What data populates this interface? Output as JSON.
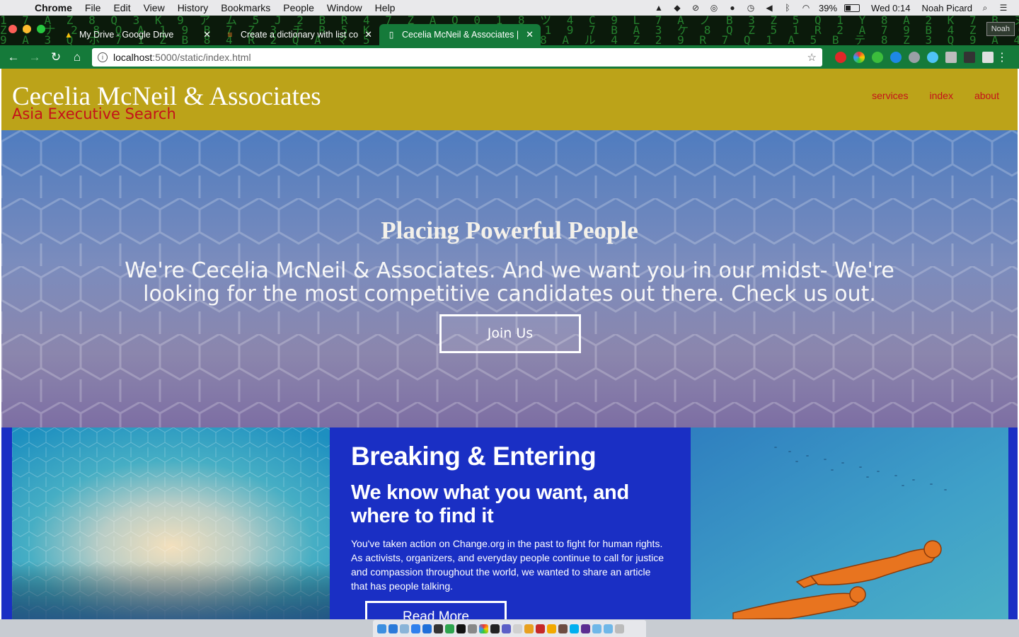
{
  "menubar": {
    "app": "Chrome",
    "items": [
      "File",
      "Edit",
      "View",
      "History",
      "Bookmarks",
      "People",
      "Window",
      "Help"
    ],
    "battery": "39%",
    "clock": "Wed 0:14",
    "user": "Noah Picard"
  },
  "browser": {
    "tabs": [
      {
        "title": "My Drive - Google Drive",
        "icon": "google-drive-icon"
      },
      {
        "title": "Create a dictionary with list co",
        "icon": "stackoverflow-icon"
      },
      {
        "title": "Cecelia McNeil & Associates | ",
        "icon": "document-icon",
        "active": true
      }
    ],
    "profile_label": "Noah",
    "url_host": "localhost",
    "url_path": ":5000/static/index.html"
  },
  "site": {
    "brand_title": "Cecelia McNeil & Associates",
    "brand_subtitle": "Asia Executive Search",
    "nav": [
      "services",
      "index",
      "about"
    ],
    "hero": {
      "title": "Placing Powerful People",
      "text": "We're Cecelia McNeil & Associates. And we want you in our midst- We're looking for the most competitive candidates out there. Check us out.",
      "button": "Join Us"
    },
    "feature": {
      "heading": "Breaking & Entering",
      "subheading": "We know what you want, and where to find it",
      "body": "You've taken action on Change.org in the past to fight for human rights. As activists, organizers, and everyday people continue to call for justice and compassion throughout the world, we wanted to share an article that has people talking.",
      "button": "Read More"
    }
  },
  "colors": {
    "header_bg": "#bca319",
    "accent_red": "#c4121a",
    "section_blue": "#1a2fc4",
    "chrome_green": "#157a3a"
  }
}
